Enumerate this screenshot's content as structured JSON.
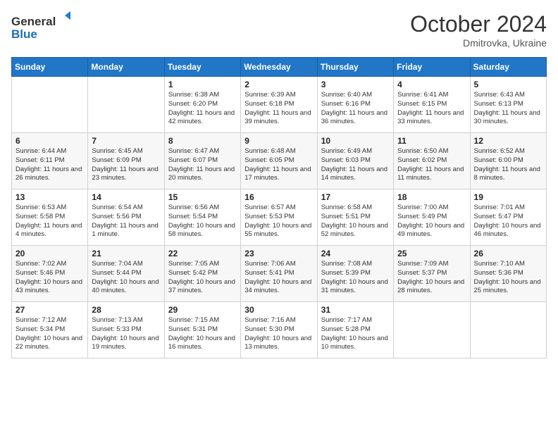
{
  "header": {
    "logo_line1": "General",
    "logo_line2": "Blue",
    "month": "October 2024",
    "location": "Dmitrovka, Ukraine"
  },
  "days_of_week": [
    "Sunday",
    "Monday",
    "Tuesday",
    "Wednesday",
    "Thursday",
    "Friday",
    "Saturday"
  ],
  "weeks": [
    [
      {
        "day": "",
        "sunrise": "",
        "sunset": "",
        "daylight": ""
      },
      {
        "day": "",
        "sunrise": "",
        "sunset": "",
        "daylight": ""
      },
      {
        "day": "1",
        "sunrise": "Sunrise: 6:38 AM",
        "sunset": "Sunset: 6:20 PM",
        "daylight": "Daylight: 11 hours and 42 minutes."
      },
      {
        "day": "2",
        "sunrise": "Sunrise: 6:39 AM",
        "sunset": "Sunset: 6:18 PM",
        "daylight": "Daylight: 11 hours and 39 minutes."
      },
      {
        "day": "3",
        "sunrise": "Sunrise: 6:40 AM",
        "sunset": "Sunset: 6:16 PM",
        "daylight": "Daylight: 11 hours and 36 minutes."
      },
      {
        "day": "4",
        "sunrise": "Sunrise: 6:41 AM",
        "sunset": "Sunset: 6:15 PM",
        "daylight": "Daylight: 11 hours and 33 minutes."
      },
      {
        "day": "5",
        "sunrise": "Sunrise: 6:43 AM",
        "sunset": "Sunset: 6:13 PM",
        "daylight": "Daylight: 11 hours and 30 minutes."
      }
    ],
    [
      {
        "day": "6",
        "sunrise": "Sunrise: 6:44 AM",
        "sunset": "Sunset: 6:11 PM",
        "daylight": "Daylight: 11 hours and 26 minutes."
      },
      {
        "day": "7",
        "sunrise": "Sunrise: 6:45 AM",
        "sunset": "Sunset: 6:09 PM",
        "daylight": "Daylight: 11 hours and 23 minutes."
      },
      {
        "day": "8",
        "sunrise": "Sunrise: 6:47 AM",
        "sunset": "Sunset: 6:07 PM",
        "daylight": "Daylight: 11 hours and 20 minutes."
      },
      {
        "day": "9",
        "sunrise": "Sunrise: 6:48 AM",
        "sunset": "Sunset: 6:05 PM",
        "daylight": "Daylight: 11 hours and 17 minutes."
      },
      {
        "day": "10",
        "sunrise": "Sunrise: 6:49 AM",
        "sunset": "Sunset: 6:03 PM",
        "daylight": "Daylight: 11 hours and 14 minutes."
      },
      {
        "day": "11",
        "sunrise": "Sunrise: 6:50 AM",
        "sunset": "Sunset: 6:02 PM",
        "daylight": "Daylight: 11 hours and 11 minutes."
      },
      {
        "day": "12",
        "sunrise": "Sunrise: 6:52 AM",
        "sunset": "Sunset: 6:00 PM",
        "daylight": "Daylight: 11 hours and 8 minutes."
      }
    ],
    [
      {
        "day": "13",
        "sunrise": "Sunrise: 6:53 AM",
        "sunset": "Sunset: 5:58 PM",
        "daylight": "Daylight: 11 hours and 4 minutes."
      },
      {
        "day": "14",
        "sunrise": "Sunrise: 6:54 AM",
        "sunset": "Sunset: 5:56 PM",
        "daylight": "Daylight: 11 hours and 1 minute."
      },
      {
        "day": "15",
        "sunrise": "Sunrise: 6:56 AM",
        "sunset": "Sunset: 5:54 PM",
        "daylight": "Daylight: 10 hours and 58 minutes."
      },
      {
        "day": "16",
        "sunrise": "Sunrise: 6:57 AM",
        "sunset": "Sunset: 5:53 PM",
        "daylight": "Daylight: 10 hours and 55 minutes."
      },
      {
        "day": "17",
        "sunrise": "Sunrise: 6:58 AM",
        "sunset": "Sunset: 5:51 PM",
        "daylight": "Daylight: 10 hours and 52 minutes."
      },
      {
        "day": "18",
        "sunrise": "Sunrise: 7:00 AM",
        "sunset": "Sunset: 5:49 PM",
        "daylight": "Daylight: 10 hours and 49 minutes."
      },
      {
        "day": "19",
        "sunrise": "Sunrise: 7:01 AM",
        "sunset": "Sunset: 5:47 PM",
        "daylight": "Daylight: 10 hours and 46 minutes."
      }
    ],
    [
      {
        "day": "20",
        "sunrise": "Sunrise: 7:02 AM",
        "sunset": "Sunset: 5:46 PM",
        "daylight": "Daylight: 10 hours and 43 minutes."
      },
      {
        "day": "21",
        "sunrise": "Sunrise: 7:04 AM",
        "sunset": "Sunset: 5:44 PM",
        "daylight": "Daylight: 10 hours and 40 minutes."
      },
      {
        "day": "22",
        "sunrise": "Sunrise: 7:05 AM",
        "sunset": "Sunset: 5:42 PM",
        "daylight": "Daylight: 10 hours and 37 minutes."
      },
      {
        "day": "23",
        "sunrise": "Sunrise: 7:06 AM",
        "sunset": "Sunset: 5:41 PM",
        "daylight": "Daylight: 10 hours and 34 minutes."
      },
      {
        "day": "24",
        "sunrise": "Sunrise: 7:08 AM",
        "sunset": "Sunset: 5:39 PM",
        "daylight": "Daylight: 10 hours and 31 minutes."
      },
      {
        "day": "25",
        "sunrise": "Sunrise: 7:09 AM",
        "sunset": "Sunset: 5:37 PM",
        "daylight": "Daylight: 10 hours and 28 minutes."
      },
      {
        "day": "26",
        "sunrise": "Sunrise: 7:10 AM",
        "sunset": "Sunset: 5:36 PM",
        "daylight": "Daylight: 10 hours and 25 minutes."
      }
    ],
    [
      {
        "day": "27",
        "sunrise": "Sunrise: 7:12 AM",
        "sunset": "Sunset: 5:34 PM",
        "daylight": "Daylight: 10 hours and 22 minutes."
      },
      {
        "day": "28",
        "sunrise": "Sunrise: 7:13 AM",
        "sunset": "Sunset: 5:33 PM",
        "daylight": "Daylight: 10 hours and 19 minutes."
      },
      {
        "day": "29",
        "sunrise": "Sunrise: 7:15 AM",
        "sunset": "Sunset: 5:31 PM",
        "daylight": "Daylight: 10 hours and 16 minutes."
      },
      {
        "day": "30",
        "sunrise": "Sunrise: 7:16 AM",
        "sunset": "Sunset: 5:30 PM",
        "daylight": "Daylight: 10 hours and 13 minutes."
      },
      {
        "day": "31",
        "sunrise": "Sunrise: 7:17 AM",
        "sunset": "Sunset: 5:28 PM",
        "daylight": "Daylight: 10 hours and 10 minutes."
      },
      {
        "day": "",
        "sunrise": "",
        "sunset": "",
        "daylight": ""
      },
      {
        "day": "",
        "sunrise": "",
        "sunset": "",
        "daylight": ""
      }
    ]
  ]
}
